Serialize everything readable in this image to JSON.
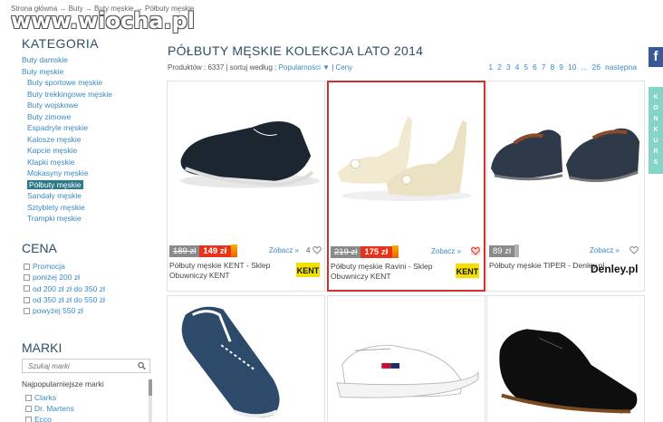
{
  "breadcrumb": "Strona główna → Buty → Buty męskie → Półbuty męskie",
  "watermark": "www.wiocha.pl",
  "sidebar": {
    "kategoria_title": "KATEGORIA",
    "categories": [
      {
        "label": "Buty damskie",
        "level": 0
      },
      {
        "label": "Buty męskie",
        "level": 0
      },
      {
        "label": "Buty sportowe męskie",
        "level": 1
      },
      {
        "label": "Buty trekkingowe męskie",
        "level": 1
      },
      {
        "label": "Buty wojskowe",
        "level": 1
      },
      {
        "label": "Buty zimowe",
        "level": 1
      },
      {
        "label": "Espadryle męskie",
        "level": 1
      },
      {
        "label": "Kalosze męskie",
        "level": 1
      },
      {
        "label": "Kapcie męskie",
        "level": 1
      },
      {
        "label": "Klapki męskie",
        "level": 1
      },
      {
        "label": "Mokasyny męskie",
        "level": 1
      },
      {
        "label": "Półbuty męskie",
        "level": 1,
        "active": true
      },
      {
        "label": "Sandały męskie",
        "level": 1
      },
      {
        "label": "Sztyblety męskie",
        "level": 1
      },
      {
        "label": "Trampki męskie",
        "level": 1
      }
    ],
    "cena_title": "CENA",
    "cena_options": [
      "Promocja",
      "poniżej 200 zł",
      "od 200 zł zł do 350 zł",
      "od 350 zł zł do 550 zł",
      "powyżej 550 zł"
    ],
    "marki_title": "MARKI",
    "marki_search_placeholder": "Szukaj marki",
    "marki_subtitle": "Najpopularniejsze marki",
    "marki": [
      "Clarks",
      "Dr. Martens",
      "Ecco"
    ]
  },
  "main": {
    "title": "PÓŁBUTY MĘSKIE KOLEKCJA LATO 2014",
    "products_label": "Produktów : 6337",
    "sort_label": "sortuj według :",
    "sort_popular": "Popularności ▼",
    "sort_price": "Ceny",
    "pagination": [
      "1",
      "2",
      "3",
      "4",
      "5",
      "6",
      "7",
      "8",
      "9",
      "10",
      "...",
      "26",
      "następna"
    ]
  },
  "products": [
    {
      "name": "Półbuty męskie KENT - Sklep Obuwniczy KENT",
      "old_price": "189 zł",
      "price": "149 zł",
      "zobacz": "Zobacz »",
      "fav_count": "4",
      "logo": "KENT"
    },
    {
      "name": "Półbuty męskie Ravini - Sklep Obuwniczy KENT",
      "old_price": "219 zł",
      "price": "175 zł",
      "zobacz": "Zobacz »",
      "fav_count": "",
      "logo": "KENT"
    },
    {
      "name": "Półbuty męskie TIPER - Denley.pl",
      "old_price": "",
      "price": "89 zł",
      "zobacz": "Zobacz »",
      "fav_count": "",
      "logo": "Denley.pl"
    }
  ],
  "side_tabs": {
    "facebook": "f",
    "konkurs": [
      "K",
      "O",
      "N",
      "K",
      "U",
      "R",
      "S"
    ]
  },
  "colors": {
    "link": "#3a8ac2",
    "heading": "#2c4f66",
    "sale": "#e8331c",
    "selected_border": "#d32f2f",
    "facebook": "#3b5998",
    "konkurs": "#86d4c6"
  }
}
